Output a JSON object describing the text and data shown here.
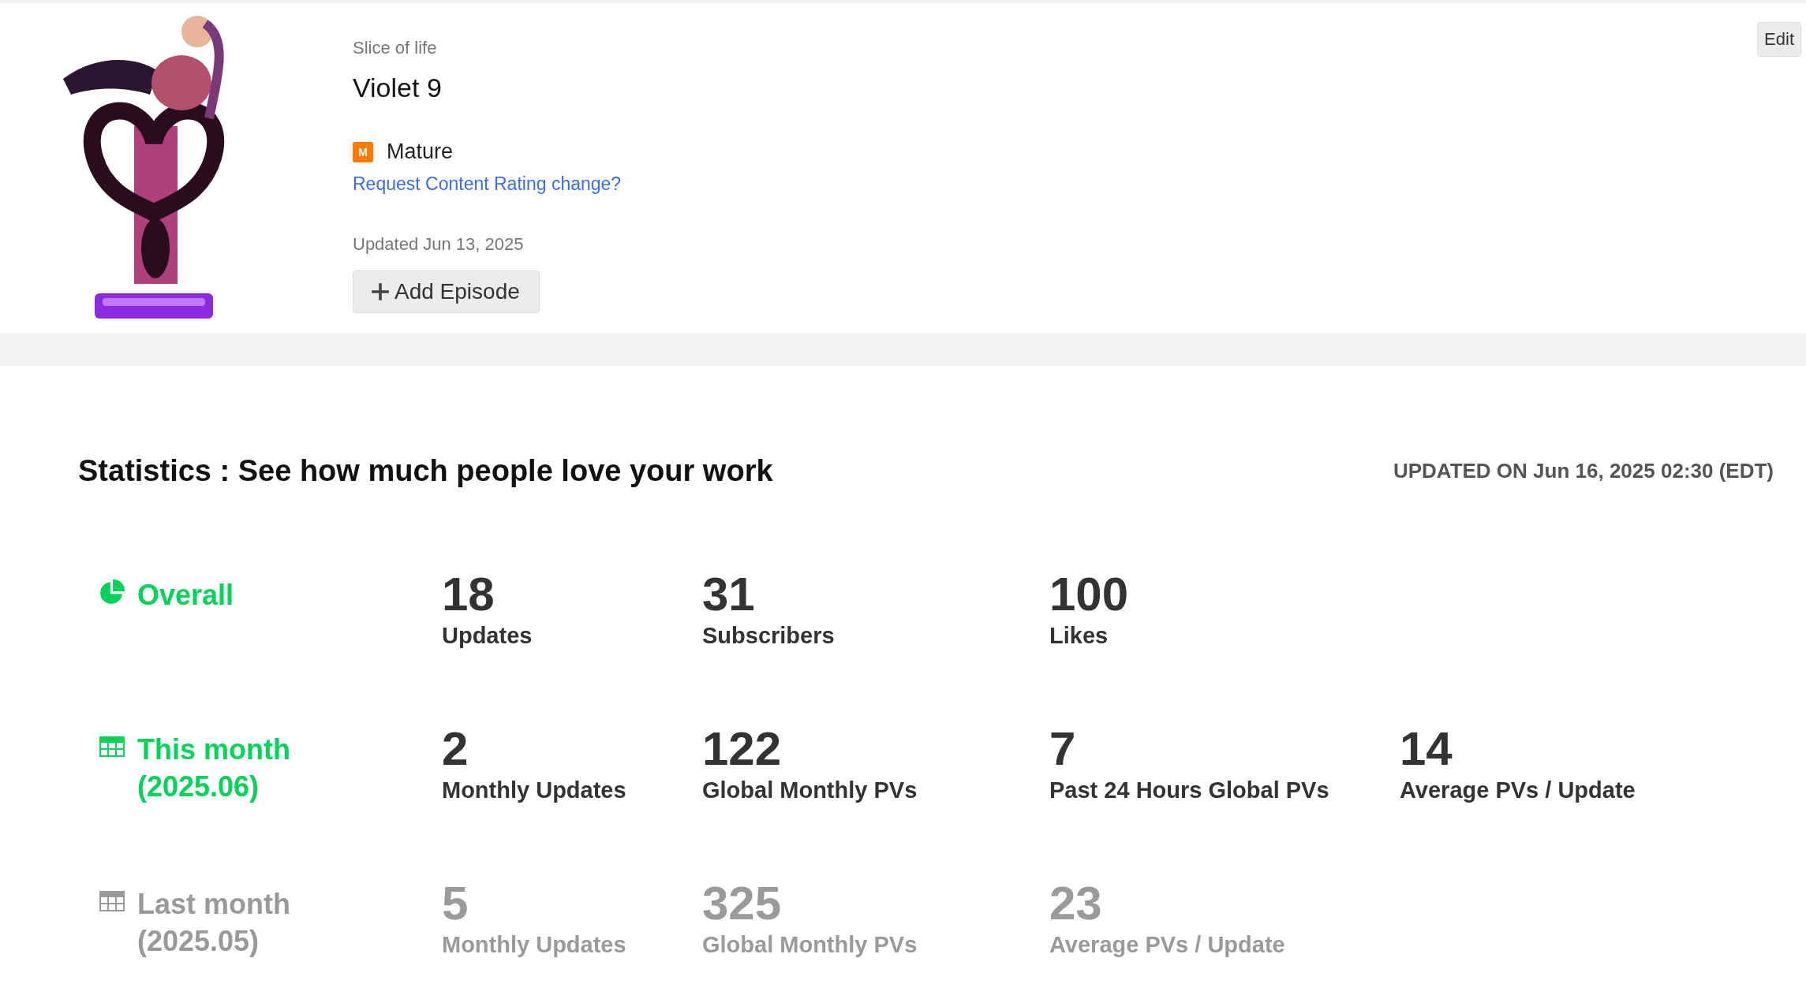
{
  "series": {
    "genre": "Slice of life",
    "title": "Violet 9",
    "rating": {
      "badge": "M",
      "label": "Mature"
    },
    "rating_link": "Request Content Rating change?",
    "updated": "Updated Jun 13, 2025",
    "add_button": "Add Episode",
    "edit_button": "Edit"
  },
  "statistics": {
    "heading": "Statistics : See how much people love your work",
    "updated_on": "UPDATED ON Jun 16, 2025 02:30 (EDT)",
    "periods": [
      {
        "kind": "overall",
        "label": "Overall",
        "active": true,
        "stats": [
          {
            "value": "18",
            "label": "Updates"
          },
          {
            "value": "31",
            "label": "Subscribers"
          },
          {
            "value": "100",
            "label": "Likes"
          }
        ]
      },
      {
        "kind": "month",
        "label": "This month",
        "period": "(2025.06)",
        "active": true,
        "stats": [
          {
            "value": "2",
            "label": "Monthly Updates"
          },
          {
            "value": "122",
            "label": "Global Monthly PVs"
          },
          {
            "value": "7",
            "label": "Past 24 Hours Global PVs"
          },
          {
            "value": "14",
            "label": "Average PVs / Update"
          }
        ]
      },
      {
        "kind": "month",
        "label": "Last month",
        "period": "(2025.05)",
        "active": false,
        "stats": [
          {
            "value": "5",
            "label": "Monthly Updates"
          },
          {
            "value": "325",
            "label": "Global Monthly PVs"
          },
          {
            "value": "23",
            "label": "Average PVs / Update"
          }
        ]
      }
    ]
  }
}
